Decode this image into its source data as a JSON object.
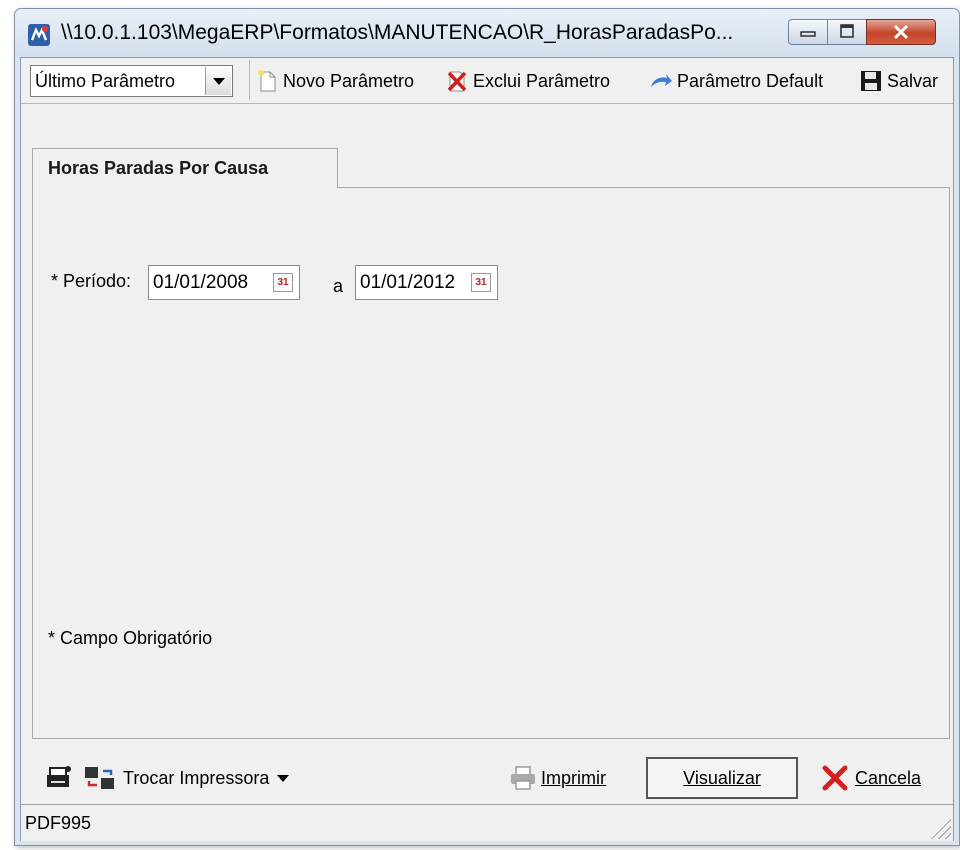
{
  "window": {
    "title": "\\\\10.0.1.103\\MegaERP\\Formatos\\MANUTENCAO\\R_HorasParadasPo..."
  },
  "toolbar": {
    "param_combo_value": "Último Parâmetro",
    "new_param_label": "Novo Parâmetro",
    "delete_param_label": "Exclui Parâmetro",
    "default_param_label": "Parâmetro Default",
    "save_label": "Salvar"
  },
  "tab": {
    "label": "Horas Paradas Por Causa"
  },
  "form": {
    "period_label": "* Período:",
    "date_from": "01/01/2008",
    "date_separator": "a",
    "date_to": "01/01/2012",
    "required_note": "* Campo Obrigatório"
  },
  "bottom": {
    "change_printer_label": "Trocar Impressora",
    "print_label": "Imprimir",
    "visualize_label": "Visualizar",
    "cancel_label": "Cancela"
  },
  "status": {
    "printer_name": "PDF995"
  },
  "colors": {
    "titlebar": "#d9e4f1",
    "close_button": "#c4452a",
    "delete_icon": "#cc2222",
    "cancel_icon": "#d62020"
  }
}
